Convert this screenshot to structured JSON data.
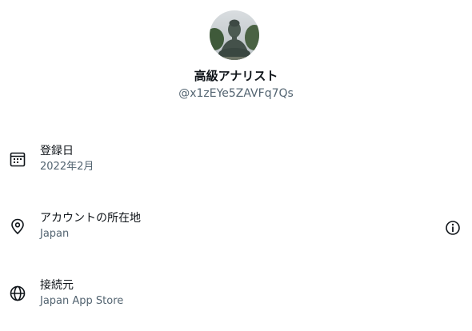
{
  "profile": {
    "display_name": "高級アナリスト",
    "handle": "@x1zEYe5ZAVFq7Qs"
  },
  "details": [
    {
      "icon": "calendar-icon",
      "title": "登録日",
      "value": "2022年2月"
    },
    {
      "icon": "location-pin-icon",
      "title": "アカウントの所在地",
      "value": "Japan",
      "action_icon": "info-icon"
    },
    {
      "icon": "globe-icon",
      "title": "接続元",
      "value": "Japan App Store"
    }
  ],
  "colors": {
    "primary_text": "#0f1419",
    "secondary_text": "#536471",
    "background": "#ffffff"
  }
}
